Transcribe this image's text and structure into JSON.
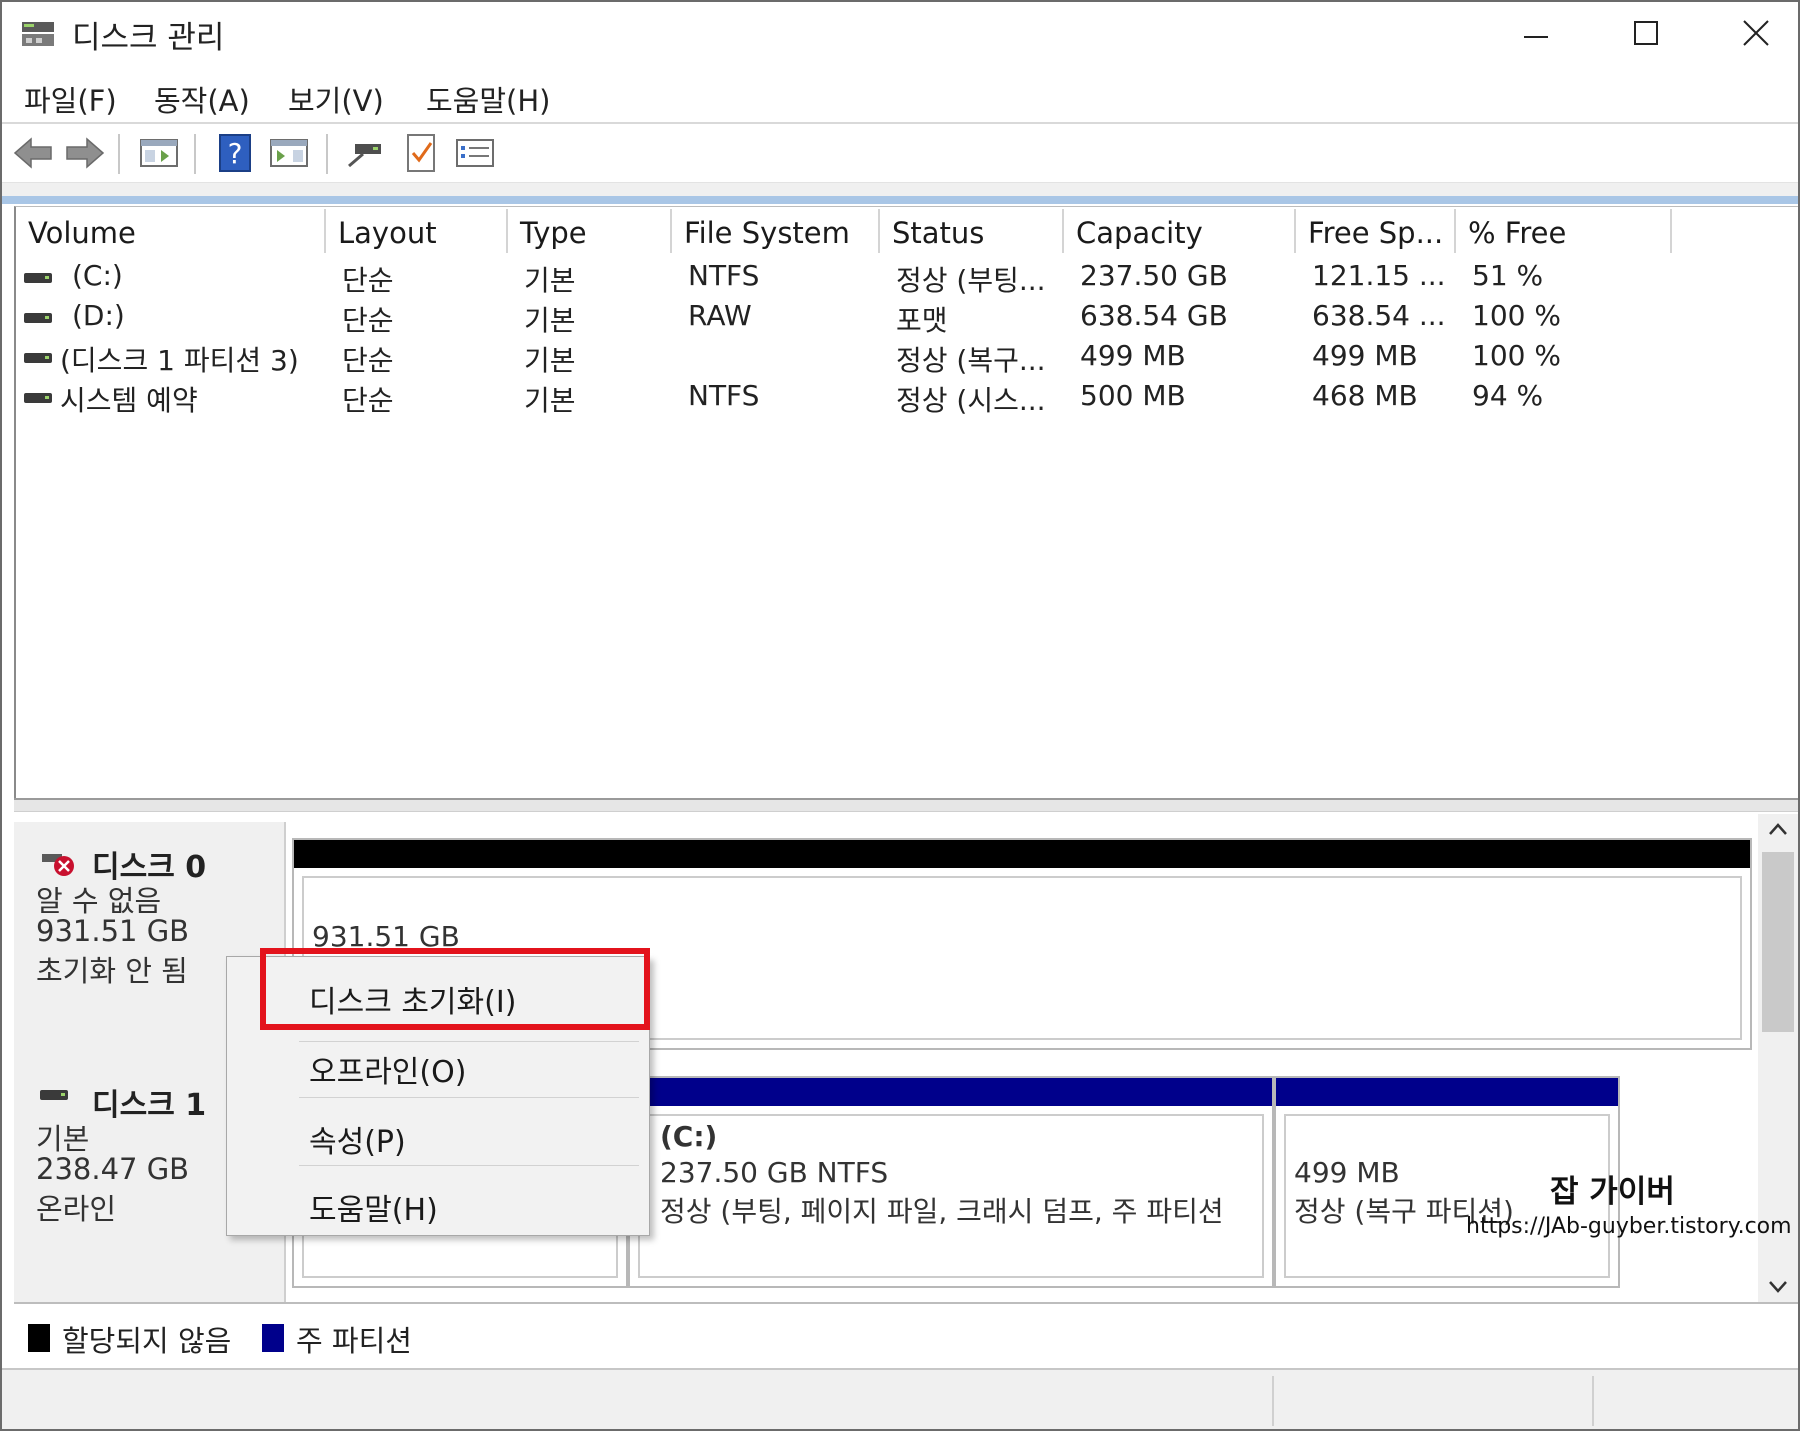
{
  "window": {
    "title": "디스크 관리"
  },
  "menu": {
    "file": "파일(F)",
    "action": "동작(A)",
    "view": "보기(V)",
    "help": "도움말(H)"
  },
  "toolbar": {
    "icons": [
      "back-arrow-icon",
      "forward-arrow-icon",
      "console-tree-icon",
      "help-icon",
      "action-pane-icon",
      "connect-drive-icon",
      "checklist-icon",
      "properties-icon"
    ]
  },
  "volume_table": {
    "columns": [
      "Volume",
      "Layout",
      "Type",
      "File System",
      "Status",
      "Capacity",
      "Free Sp...",
      "% Free"
    ],
    "rows": [
      {
        "volume": "(C:)",
        "layout": "단순",
        "type": "기본",
        "fs": "NTFS",
        "status": "정상 (부팅...",
        "capacity": "237.50 GB",
        "free": "121.15 ...",
        "pct": "51 %"
      },
      {
        "volume": "(D:)",
        "layout": "단순",
        "type": "기본",
        "fs": "RAW",
        "status": "포맷",
        "capacity": "638.54 GB",
        "free": "638.54 ...",
        "pct": "100 %"
      },
      {
        "volume": "(디스크 1 파티션 3)",
        "layout": "단순",
        "type": "기본",
        "fs": "",
        "status": "정상 (복구...",
        "capacity": "499 MB",
        "free": "499 MB",
        "pct": "100 %"
      },
      {
        "volume": "시스템 예약",
        "layout": "단순",
        "type": "기본",
        "fs": "NTFS",
        "status": "정상 (시스...",
        "capacity": "500 MB",
        "free": "468 MB",
        "pct": "94 %"
      }
    ]
  },
  "disk0": {
    "name": "디스크 0",
    "kind": "알 수 없음",
    "size": "931.51 GB",
    "state": "초기화 안 됨",
    "partition_size": "931.51 GB"
  },
  "disk1": {
    "name": "디스크 1",
    "kind": "기본",
    "size": "238.47 GB",
    "state": "온라인",
    "part_c_name": "(C:)",
    "part_c_size": "237.50 GB NTFS",
    "part_c_status": "정상 (부팅, 페이지 파일, 크래시 덤프, 주 파티션",
    "part_r_size": "499 MB",
    "part_r_status": "정상 (복구 파티션)"
  },
  "legend": {
    "unallocated": "할당되지 않음",
    "primary": "주 파티션"
  },
  "context_menu": {
    "items": [
      "디스크 초기화(I)",
      "오프라인(O)",
      "속성(P)",
      "도움말(H)"
    ]
  },
  "watermark": {
    "title": "잡 가이버",
    "url": "https://JAb-guyber.tistory.com"
  },
  "colors": {
    "unallocated": "#000000",
    "primary_partition": "#00008b",
    "highlight": "#e3131c"
  }
}
